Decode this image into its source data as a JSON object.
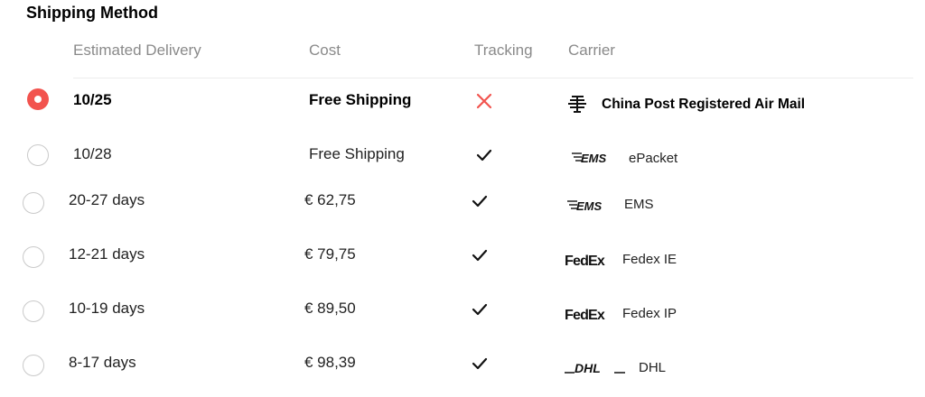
{
  "title": "Shipping Method",
  "headers": {
    "delivery": "Estimated Delivery",
    "cost": "Cost",
    "tracking": "Tracking",
    "carrier": "Carrier"
  },
  "rows": [
    {
      "delivery": "10/25",
      "cost": "Free Shipping",
      "tracking": "none",
      "carrier": "China Post Registered Air Mail",
      "logo": "china-post-logo",
      "selected": true
    },
    {
      "delivery": "10/28",
      "cost": "Free Shipping",
      "tracking": "available",
      "carrier": "ePacket",
      "logo_text": "EMS",
      "logo": "ems-logo",
      "selected": false
    },
    {
      "delivery": "20-27 days",
      "cost": "€ 62,75",
      "tracking": "available",
      "carrier": "EMS",
      "logo_text": "EMS",
      "logo": "ems-logo",
      "selected": false
    },
    {
      "delivery": "12-21 days",
      "cost": "€ 79,75",
      "tracking": "available",
      "carrier": "Fedex IE",
      "logo_text": "FedEx",
      "logo": "fedex-logo",
      "selected": false
    },
    {
      "delivery": "10-19 days",
      "cost": "€ 89,50",
      "tracking": "available",
      "carrier": "Fedex IP",
      "logo_text": "FedEx",
      "logo": "fedex-logo",
      "selected": false
    },
    {
      "delivery": "8-17 days",
      "cost": "€ 98,39",
      "tracking": "available",
      "carrier": "DHL",
      "logo_text": "DHL",
      "logo": "dhl-logo",
      "selected": false
    }
  ],
  "colors": {
    "accent": "#f2534e",
    "header_text": "#8a8a8a",
    "divider": "#ececec"
  }
}
